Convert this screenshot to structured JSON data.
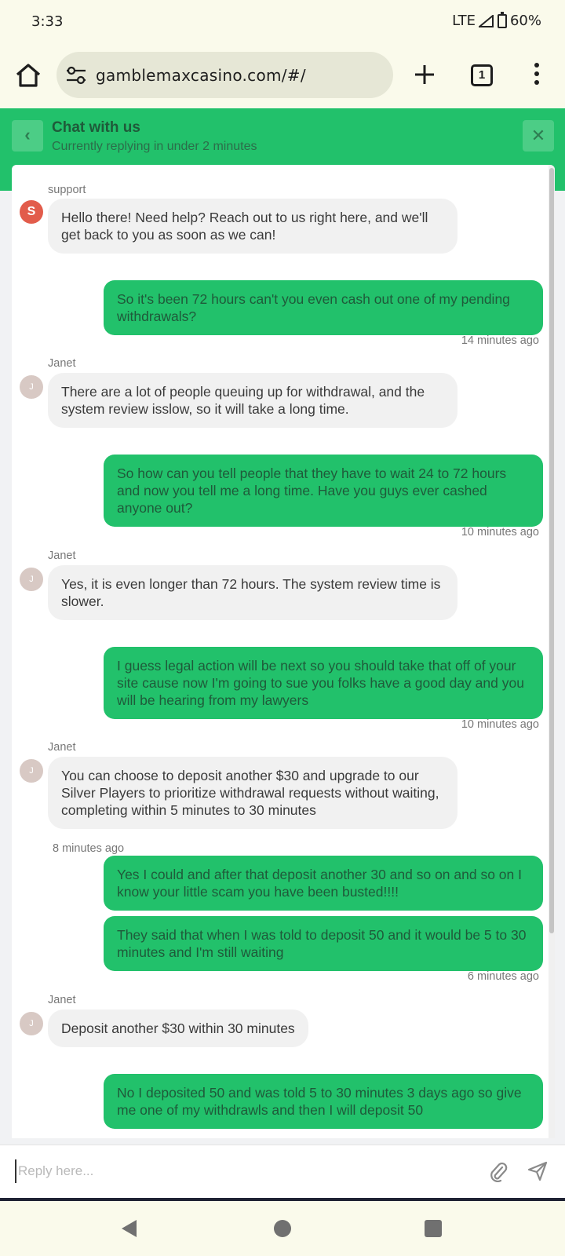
{
  "status_bar": {
    "time": "3:33",
    "network": "LTE",
    "battery": "60%"
  },
  "browser": {
    "url": "gamblemaxcasino.com/#/",
    "tab_count": "1"
  },
  "chat_header": {
    "title": "Chat with us",
    "subtitle": "Currently replying in under 2 minutes",
    "back_glyph": "‹",
    "close_glyph": "✕"
  },
  "messages": [
    {
      "sender": "support",
      "avatar_letter": "S",
      "text": "Hello there! Need help? Reach out to us right here, and we'll get back to you as soon as we can!"
    },
    {
      "text": "So it's been 72 hours can't you even cash out one of my pending withdrawals?",
      "time": "14 minutes ago"
    },
    {
      "sender": "Janet",
      "avatar_letter": "J",
      "text": "There are a lot of people queuing up for withdrawal, and the system review isslow, so it will take a long time."
    },
    {
      "text": "So how can you tell people that they have to wait 24 to 72 hours and now you tell me a long time. Have you guys ever cashed anyone out?",
      "time": "10 minutes ago"
    },
    {
      "sender": "Janet",
      "avatar_letter": "J",
      "text": "Yes, it is even longer than 72 hours. The system review time is slower."
    },
    {
      "text": "I guess legal action will be next so you should take that off of your site cause now I'm going to sue you folks have a good day and you will be hearing from my lawyers",
      "time": "10 minutes ago"
    },
    {
      "sender": "Janet",
      "avatar_letter": "J",
      "text": "You can choose to deposit another $30 and upgrade to our Silver Players to prioritize withdrawal requests without waiting, completing within 5 minutes to 30 minutes",
      "time": "8 minutes ago"
    },
    {
      "text": "Yes I could and after that deposit another 30 and so on and so on I know your little scam you have been busted!!!!"
    },
    {
      "text": "They said that when I was told to deposit 50 and it would be 5 to 30 minutes and I'm still waiting",
      "time": "6 minutes ago"
    },
    {
      "sender": "Janet",
      "avatar_letter": "J",
      "text": "Deposit another $30 within 30 minutes"
    },
    {
      "text": "No I deposited 50 and was told 5 to 30 minutes 3 days ago so give me one of my withdrawls and then I will deposit 50"
    }
  ],
  "reply": {
    "placeholder": "Reply here..."
  },
  "icons": {
    "home": "home-icon",
    "site_settings": "tune-icon",
    "new_tab": "plus-icon",
    "tabs": "tabs-icon",
    "menu": "more-vert-icon",
    "attach": "paperclip-icon",
    "send": "send-icon",
    "nav_back": "triangle-back-icon",
    "nav_home": "circle-home-icon",
    "nav_recent": "square-recent-icon"
  },
  "colors": {
    "brand_green": "#22c16b",
    "incoming_bubble": "#f1f1f1",
    "support_avatar": "#e25c4b",
    "agent_avatar": "#d8c9c4",
    "chrome_bg": "#fafaeb"
  }
}
